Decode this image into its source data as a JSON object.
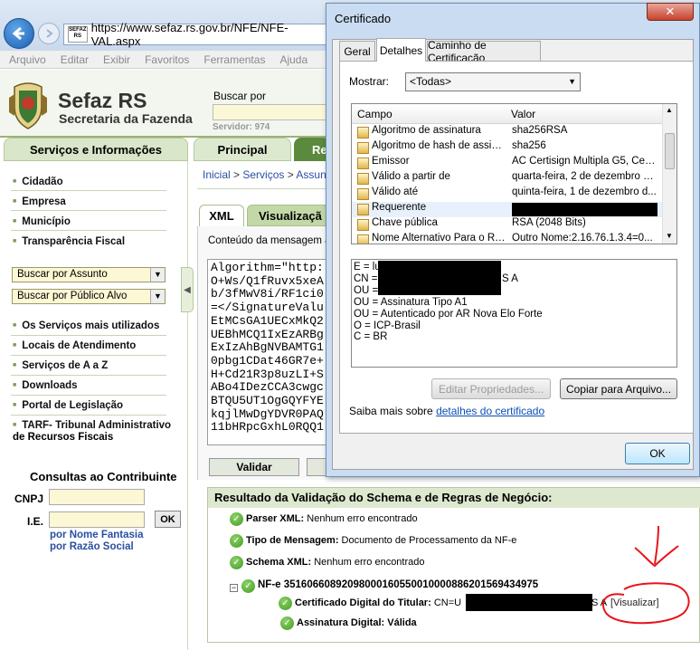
{
  "browser": {
    "url": "https://www.sefaz.rs.gov.br/NFE/NFE-VAL.aspx",
    "site_badge": "SEFAZ RS",
    "menu": [
      "Arquivo",
      "Editar",
      "Exibir",
      "Favoritos",
      "Ferramentas",
      "Ajuda"
    ]
  },
  "header": {
    "title": "Sefaz RS",
    "subtitle": "Secretaria da Fazenda",
    "search_label": "Buscar por",
    "server": "Servidor: 974"
  },
  "tabs": {
    "servicos": "Serviços e Informações",
    "principal": "Principal",
    "re": "Re"
  },
  "sidebar": {
    "items": [
      "Cidadão",
      "Empresa",
      "Município",
      "Transparência Fiscal"
    ],
    "select_assunto": "Buscar por Assunto",
    "select_publico": "Buscar por Público Alvo",
    "items2": [
      "Os Serviços mais utilizados",
      "Locais de Atendimento",
      "Serviços de A a Z",
      "Downloads",
      "Portal de Legislação",
      "TARF- Tribunal Administrativo"
    ],
    "tarf_line2": "de Recursos Fiscais",
    "consultas_title": "Consultas ao Contribuinte",
    "cnpj_label": "CNPJ",
    "ie_label": "I.E.",
    "ok_label": "OK",
    "fantasia_link": "por Nome Fantasia",
    "razao_link": "por Razão Social"
  },
  "main": {
    "breadcrumb": [
      "Inicial",
      "Serviços",
      "Assun"
    ],
    "tab_xml": "XML",
    "tab_vis": "Visualizaçã",
    "content_label": "Conteúdo da mensagem a",
    "xml_lines": [
      "Algorithm=\"http:",
      "O+Ws/Q1fRuvx5xeA",
      "b/3fMwV8i/RF1ci0",
      "=</SignatureValu",
      "EtMCsGA1UECxMkQ2",
      "UEBhMCQ1IxEzARBg",
      "ExIzAhBgNVBAMTG1",
      "0pbg1CDat46GR7e+",
      "H+Cd21R3p8uzLI+S",
      "ABo4IDezCCA3cwgc",
      "BTQU5UT1OgGQYFYE",
      "kqjlMwDgYDVR0PAQ",
      "11bHRpcGxhL0RQQ1"
    ],
    "validar_label": "Validar"
  },
  "result": {
    "title": "Resultado da Validação do Schema e de Regras de Negócio:",
    "rows": [
      {
        "label": "Parser XML:",
        "value": "Nenhum erro encontrado"
      },
      {
        "label": "Tipo de Mensagem:",
        "value": "Documento de Processamento da NF-e"
      },
      {
        "label": "Schema XML:",
        "value": "Nenhum erro encontrado"
      }
    ],
    "nfe_label": "NF-e 35160660892098000160550010000886201569434975",
    "cert_label": "Certificado Digital do Titular:",
    "cert_value_prefix": "CN=U",
    "cert_value_suffix": "S A",
    "visualizar": "[Visualizar]",
    "assinatura_label": "Assinatura Digital:",
    "assinatura_value": "Válida"
  },
  "dialog": {
    "title": "Certificado",
    "close": "✕",
    "tabs": [
      "Geral",
      "Detalhes",
      "Caminho de Certificação"
    ],
    "mostrar_label": "Mostrar:",
    "mostrar_value": "<Todas>",
    "col_campo": "Campo",
    "col_valor": "Valor",
    "fields": [
      {
        "name": "Algoritmo de assinatura",
        "value": "sha256RSA"
      },
      {
        "name": "Algoritmo de hash de assina...",
        "value": "sha256"
      },
      {
        "name": "Emissor",
        "value": "AC Certisign Multipla G5, Certi..."
      },
      {
        "name": "Válido a partir de",
        "value": "quarta-feira, 2 de dezembro d..."
      },
      {
        "name": "Válido até",
        "value": "quinta-feira, 1 de dezembro d..."
      },
      {
        "name": "Requerente",
        "value": ""
      },
      {
        "name": "Chave pública",
        "value": "RSA (2048 Bits)"
      },
      {
        "name": "Nome Alternativo Para o Re...",
        "value": "Outro Nome:2.16.76.1.3.4=0..."
      }
    ],
    "detail_lines": [
      "E = lu",
      "CN =",
      "OU =",
      "OU = Assinatura Tipo A1",
      "OU = Autenticado por AR Nova Elo Forte",
      "O = ICP-Brasil",
      "C = BR"
    ],
    "detail_cn_suffix": "S A",
    "btn_editar": "Editar Propriedades...",
    "btn_copiar": "Copiar para Arquivo...",
    "saiba_text": "Saiba mais sobre",
    "saiba_link": "detalhes do certificado",
    "ok_label": "OK"
  },
  "colors": {
    "sefaz_green": "#5b8a3e",
    "annotation_red": "#e8141c",
    "link_blue": "#2a4fa3"
  }
}
